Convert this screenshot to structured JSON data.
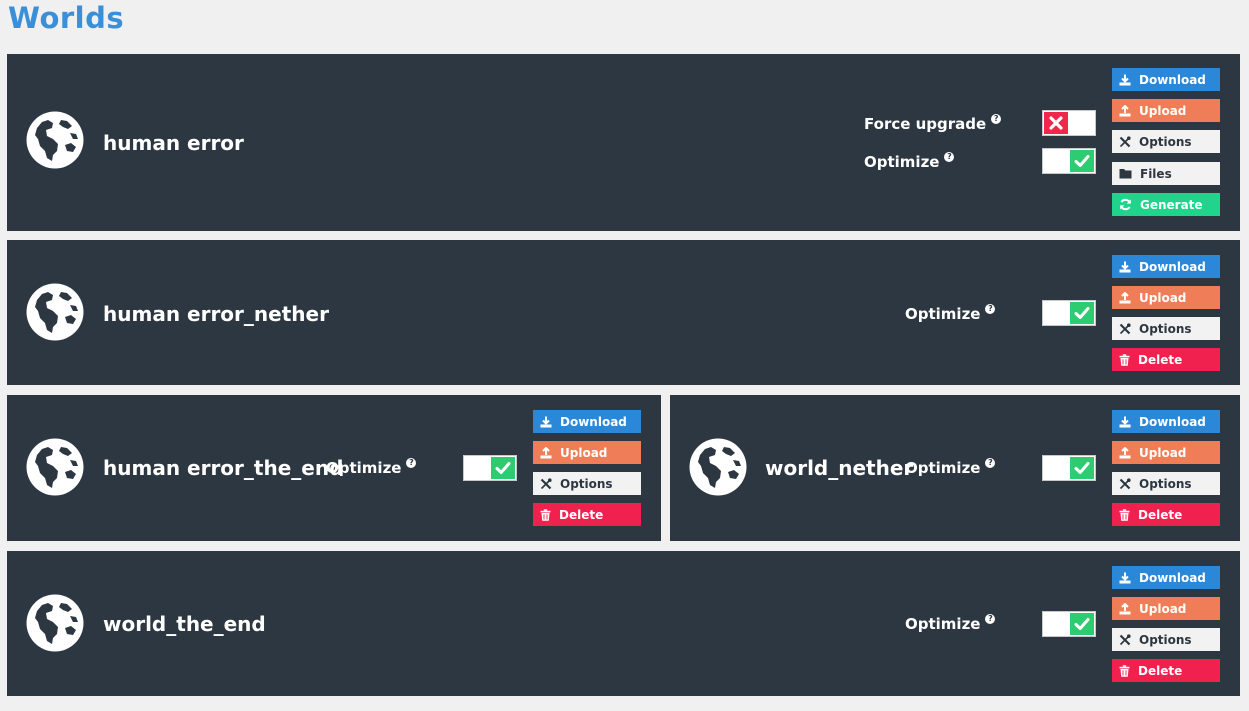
{
  "page": {
    "title": "Worlds"
  },
  "labels": {
    "force_upgrade": "Force upgrade",
    "optimize": "Optimize",
    "help": "?"
  },
  "buttons": {
    "download": "Download",
    "upload": "Upload",
    "options": "Options",
    "files": "Files",
    "generate": "Generate",
    "delete": "Delete"
  },
  "colors": {
    "title": "#3a8fd9",
    "card": "#2d3741",
    "download": "#2b88d8",
    "upload": "#ef7e58",
    "generate": "#21d48c",
    "delete": "#f0214e",
    "toggle_on": "#2ecc71",
    "toggle_off": "#f0274b"
  },
  "worlds": [
    {
      "name": "human error",
      "force_upgrade": false,
      "optimize": true
    },
    {
      "name": "human error_nether",
      "optimize": true
    },
    {
      "name": "human error_the_end",
      "optimize": true
    },
    {
      "name": "world_nether",
      "optimize": true
    },
    {
      "name": "world_the_end",
      "optimize": true
    }
  ]
}
